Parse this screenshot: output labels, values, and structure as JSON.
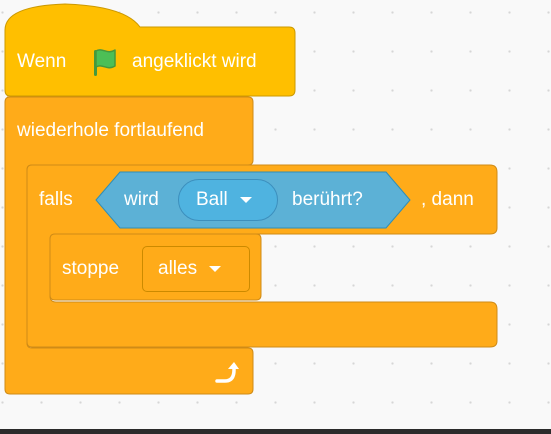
{
  "workspace": {
    "hat_block": {
      "prefix": "Wenn",
      "icon": "green-flag-icon",
      "suffix": "angeklickt wird"
    },
    "forever_block": {
      "label": "wiederhole fortlaufend",
      "loop_icon": "loop-arrow-icon"
    },
    "if_block": {
      "prefix": "falls",
      "condition": {
        "prefix": "wird",
        "selected": "Ball",
        "suffix": "berührt?"
      },
      "suffix": ", dann"
    },
    "stop_block": {
      "label": "stoppe",
      "selected": "alles"
    }
  },
  "colors": {
    "events": "#ffbf00",
    "control": "#ffab19",
    "sensing": "#5cb1d6",
    "control_border": "#cf8b17"
  }
}
